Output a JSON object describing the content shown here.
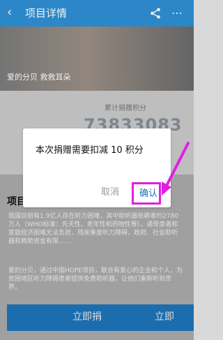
{
  "topbar": {
    "back_icon": "chevron-left-icon",
    "title": "项目详情",
    "share_icon": "share-icon",
    "more_icon": "more-icon"
  },
  "banner": {
    "text": "爱的分贝 救救耳朵"
  },
  "stats": {
    "label": "累计捐赠积分",
    "value": "73833083"
  },
  "section": {
    "title": "项目",
    "para1": "我国目前有1.9亿人存在听力困难，其中助听器依赖者约2780万人（WHO标准：先天性、老年性和药物性等）。通常患者和家庭经济困难无法负担，残疾重度听力障碍，政府、社会助听器和救助资金有限……",
    "para2": "爱的分贝，通过中国HOPE项目，联合有爱心的企业和个人，为贫困地区听力障碍患者提供免费助听器，让他们重新听到世界。"
  },
  "footer": {
    "donate_now": "立即捐",
    "donate_right": "立即"
  },
  "dialog": {
    "message": "本次捐赠需要扣减 10 积分",
    "cancel": "取消",
    "confirm": "确认"
  },
  "colors": {
    "header": "#2f8fd3",
    "confirm": "#1d73b8",
    "highlight": "#e020e0"
  }
}
